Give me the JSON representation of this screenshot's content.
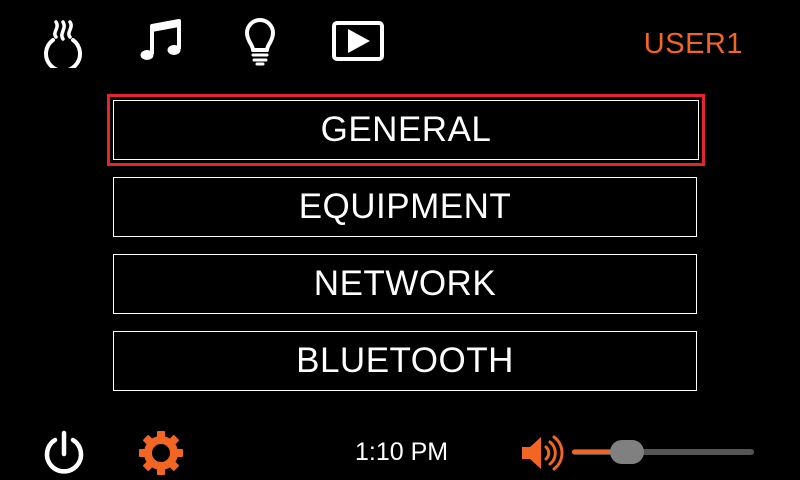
{
  "header": {
    "icons": [
      "spa-heat-icon",
      "music-note-icon",
      "light-bulb-icon",
      "video-play-icon"
    ],
    "user_label": "USER1"
  },
  "menu": {
    "items": [
      {
        "label": "GENERAL",
        "selected": true
      },
      {
        "label": "EQUIPMENT",
        "selected": false
      },
      {
        "label": "NETWORK",
        "selected": false
      },
      {
        "label": "BLUETOOTH",
        "selected": false
      }
    ],
    "selected_color": "#e3262e"
  },
  "footer": {
    "icons": [
      "power-icon",
      "settings-gear-icon",
      "speaker-icon"
    ],
    "time": "1:10 PM",
    "volume_level": 0.3
  },
  "colors": {
    "accent": "#f26522",
    "background": "#000000",
    "text": "#ffffff"
  }
}
